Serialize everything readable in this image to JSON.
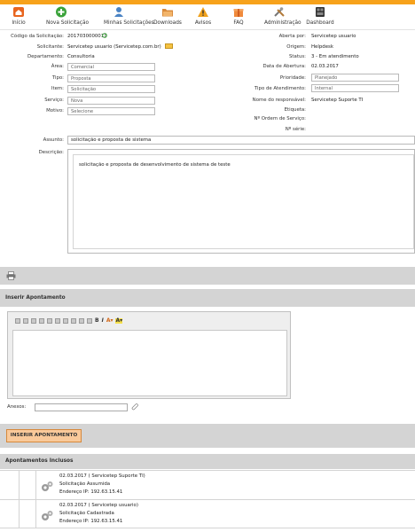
{
  "toolbar": {
    "items": [
      {
        "label": "Início",
        "icon": "home-icon"
      },
      {
        "label": "Nova Solicitação",
        "icon": "add-icon"
      },
      {
        "label": "Minhas Solicitações",
        "icon": "user-icon"
      },
      {
        "label": "Downloads",
        "icon": "folder-icon"
      },
      {
        "label": "Avisos",
        "icon": "warning-icon"
      },
      {
        "label": "FAQ",
        "icon": "gift-icon"
      },
      {
        "label": "Administração",
        "icon": "tools-icon"
      },
      {
        "label": "Dashboard",
        "icon": "dashboard-icon"
      }
    ]
  },
  "request": {
    "codigo_label": "Código da Solicitação:",
    "codigo_value": "2017030000011",
    "solicitante_label": "Solicitante:",
    "solicitante_value": "Servicetep usuario (Servicetep.com.br)",
    "departamento_label": "Departamento:",
    "departamento_value": "Consultoria",
    "area_label": "Área:",
    "area_value": "Comercial",
    "tipo_label": "Tipo:",
    "tipo_value": "Proposta",
    "item_label": "Item:",
    "item_value": "Solicitação",
    "servico_label": "Serviço:",
    "servico_value": "Nova",
    "motivo_label": "Motivo:",
    "motivo_value": "Selecione",
    "aberta_por_label": "Aberta por:",
    "aberta_por_value": "Servicetep usuario",
    "origem_label": "Origem:",
    "origem_value": "Helpdesk",
    "status_label": "Status:",
    "status_value": "3 - Em atendimento",
    "data_abertura_label": "Data de Abertura:",
    "data_abertura_value": "02.03.2017",
    "prioridade_label": "Prioridade:",
    "prioridade_value": "Planejado",
    "tipo_atendimento_label": "Tipo de Atendimento:",
    "tipo_atendimento_value": "Internal",
    "responsavel_label": "Nome do responsável:",
    "responsavel_value": "Servicetep Suporte TI",
    "etiqueta_label": "Etiqueta:",
    "ordem_servico_label": "Nº Ordem de Serviço:",
    "serie_label": "Nº série:",
    "assunto_label": "Assunto:",
    "assunto_value": "solicitação e proposta de sistema",
    "descricao_label": "Descrição:",
    "descricao_value": "solicitação e proposta de desenvolvimento de sistema de teste"
  },
  "sections": {
    "inserir_apontamento": "Inserir Apontamento",
    "anexos_label": "Anexos:",
    "inserir_button": "INSERIR APONTAMENTO",
    "apontamentos_inclusos": "Apontamentos Inclusos"
  },
  "apontamentos": [
    {
      "header": "02.03.2017 ( Servicetep Suporte TI)",
      "action": "Solicitação Assumida",
      "address": "Endereço IP: 192.63.15.41"
    },
    {
      "header": "02.03.2017 ( Servicetep usuario)",
      "action": "Solicitação Cadastrada",
      "address": "Endereço IP: 192.63.15.41"
    }
  ],
  "colors": {
    "accent": "#f7a21b",
    "band": "#d4d4d4",
    "button": "#f9c99a"
  }
}
